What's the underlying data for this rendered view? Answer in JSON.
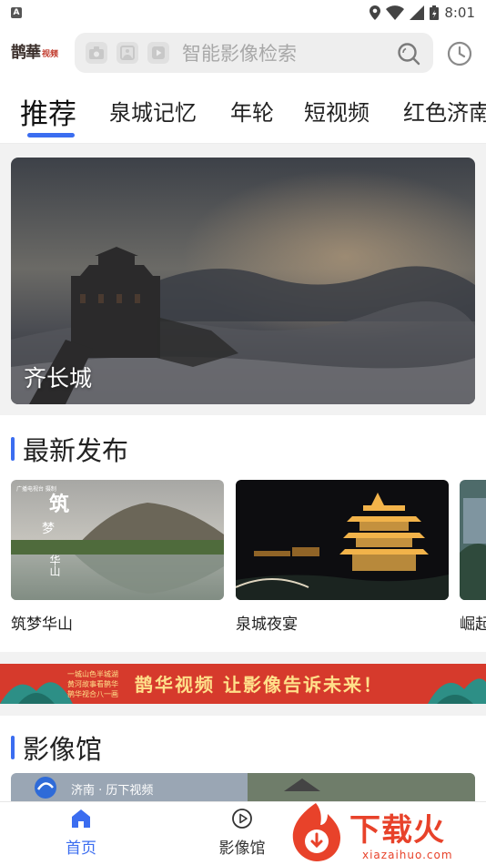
{
  "status_bar": {
    "time": "8:01",
    "left_indicator": "A"
  },
  "header": {
    "logo_text": "鹊華",
    "logo_sub": "视频",
    "search_placeholder": "智能影像检索"
  },
  "tabs": [
    {
      "label": "推荐",
      "active": true
    },
    {
      "label": "泉城记忆",
      "active": false
    },
    {
      "label": "年轮",
      "active": false
    },
    {
      "label": "短视频",
      "active": false
    },
    {
      "label": "红色济南",
      "active": false
    }
  ],
  "hero": {
    "title": "齐长城"
  },
  "latest": {
    "section_title": "最新发布",
    "items": [
      {
        "label": "筑梦华山",
        "overlay_big": "筑",
        "overlay_small": "梦",
        "overlay_small2": "华山",
        "overlay_corner": "广播电视台 摄制"
      },
      {
        "label": "泉城夜宴"
      },
      {
        "label": "崛起"
      }
    ]
  },
  "banner": {
    "slogan": "鹊华视频 让影像告诉未来！",
    "small_lines": [
      "一城山色半城湖",
      "黄河故事看鹊华",
      "鹊华视合八一画"
    ]
  },
  "gallery": {
    "section_title": "影像馆",
    "preview_caption": "济南 · 历下视频"
  },
  "bottom_nav": [
    {
      "label": "首页",
      "active": true,
      "icon": "home-icon"
    },
    {
      "label": "影像馆",
      "active": false,
      "icon": "play-circle-icon"
    }
  ],
  "watermark": {
    "brand": "下载火",
    "url": "xiazaihuo.com"
  },
  "colors": {
    "accent": "#3b6df0",
    "banner_red": "#d63a2c",
    "watermark_red": "#e8422a"
  }
}
